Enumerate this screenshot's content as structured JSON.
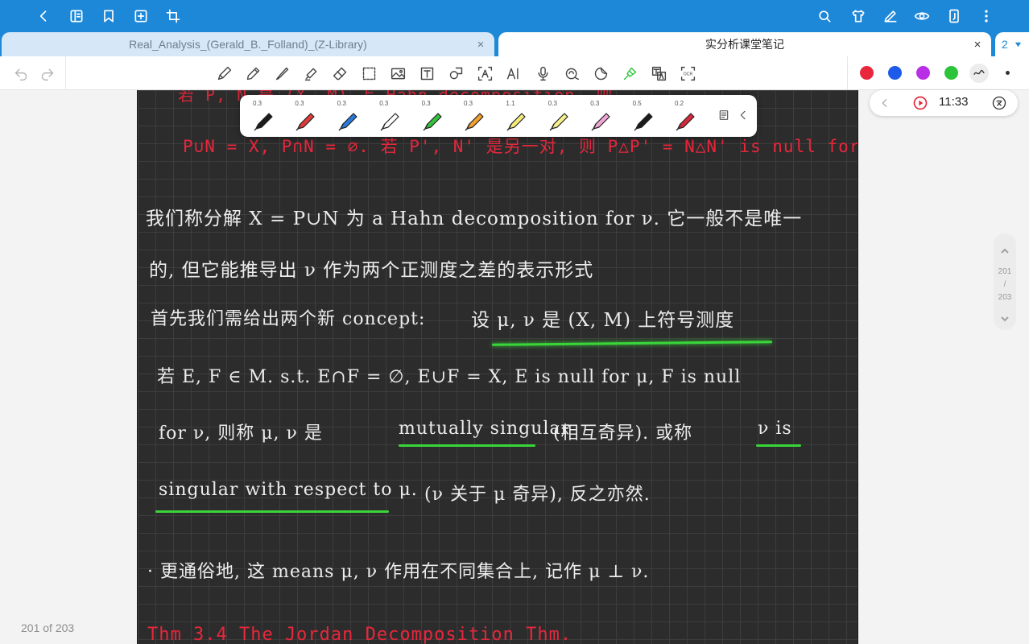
{
  "tabs": [
    {
      "title": "Real_Analysis_(Gerald_B._Folland)_(Z-Library)",
      "close": "×"
    },
    {
      "title": "实分析课堂笔记",
      "close": "×"
    }
  ],
  "tab_count": "2",
  "colors": {
    "accent": "#1e88d8",
    "red": "#e8273c",
    "blue": "#1e5bea",
    "purple": "#b82fe6",
    "green": "#2cc43a"
  },
  "pens": [
    {
      "size": "0.3",
      "color": "#1a1a1a"
    },
    {
      "size": "0.3",
      "color": "#e03b3b"
    },
    {
      "size": "0.3",
      "color": "#2a78d8"
    },
    {
      "size": "0.3",
      "color": "#ffffff"
    },
    {
      "size": "0.3",
      "color": "#34c23c"
    },
    {
      "size": "0.3",
      "color": "#f0a030"
    },
    {
      "size": "1.1",
      "color": "#f4ec7a"
    },
    {
      "size": "0.3",
      "color": "#f6f08a"
    },
    {
      "size": "0.3",
      "color": "#f2a6d6"
    },
    {
      "size": "0.5",
      "color": "#1a1a1a"
    },
    {
      "size": "0.2",
      "color": "#d8283c"
    }
  ],
  "audio": {
    "time": "11:33"
  },
  "page_indicator": {
    "current": "201",
    "sep": "/",
    "total": "203"
  },
  "page_count_text": "201 of 203",
  "note": {
    "line0": "若 P, N 是 (X, M) 上 Hahn decomposition, 则",
    "line1": "P∪N = X, P∩N = ∅. 若 P', N' 是另一对, 则 P△P' = N△N' is null for ν.",
    "line2": "我们称分解 X = P∪N 为 a Hahn decomposition for ν. 它一般不是唯一",
    "line3": "的, 但它能推导出 ν 作为两个正测度之差的表示形式",
    "line4a": "首先我们需给出两个新 concept:",
    "line4b": "设 μ, ν 是 (X, M) 上符号测度",
    "line5": "若 E, F ∈ M. s.t. E∩F = ∅, E∪F = X, E is null for μ, F is null",
    "line6a": "for ν, 则称 μ, ν 是",
    "line6b": "mutually singular",
    "line6c": "(相互奇异). 或称",
    "line6d": "ν is",
    "line7a": "singular with respect to μ.",
    "line7b": "(ν 关于 μ 奇异), 反之亦然.",
    "line8": "· 更通俗地, 这 means μ, ν 作用在不同集合上, 记作 μ ⊥ ν.",
    "line9": "Thm 3.4   The Jordan Decomposition Thm."
  }
}
